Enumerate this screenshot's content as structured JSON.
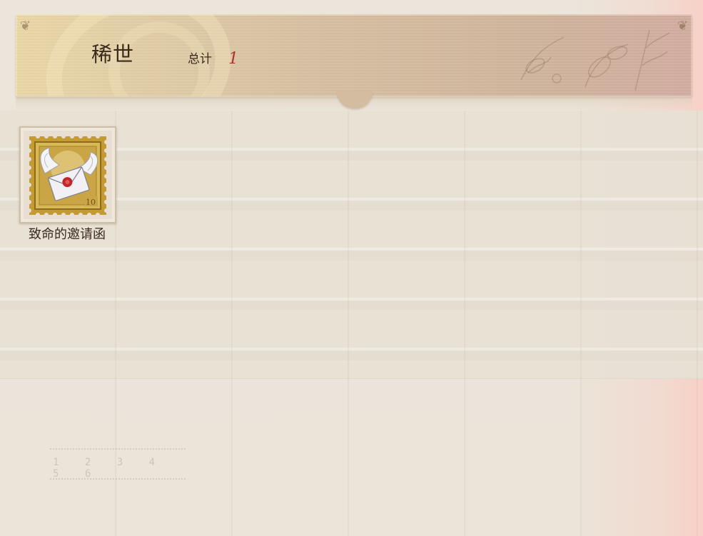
{
  "header": {
    "title": "稀世",
    "total_label": "总计",
    "total_count": "1"
  },
  "items": [
    {
      "name": "致命的邀请函",
      "icon": "winged-letter-stamp-icon",
      "stamp_denomination": "10"
    }
  ],
  "background": {
    "ruler_digits": "1 2 3 4 5 6"
  },
  "colors": {
    "title_text": "#3a2a1e",
    "count_accent": "#b0302a",
    "stamp_gold": "#c9a640",
    "seal_red": "#c0262b"
  }
}
